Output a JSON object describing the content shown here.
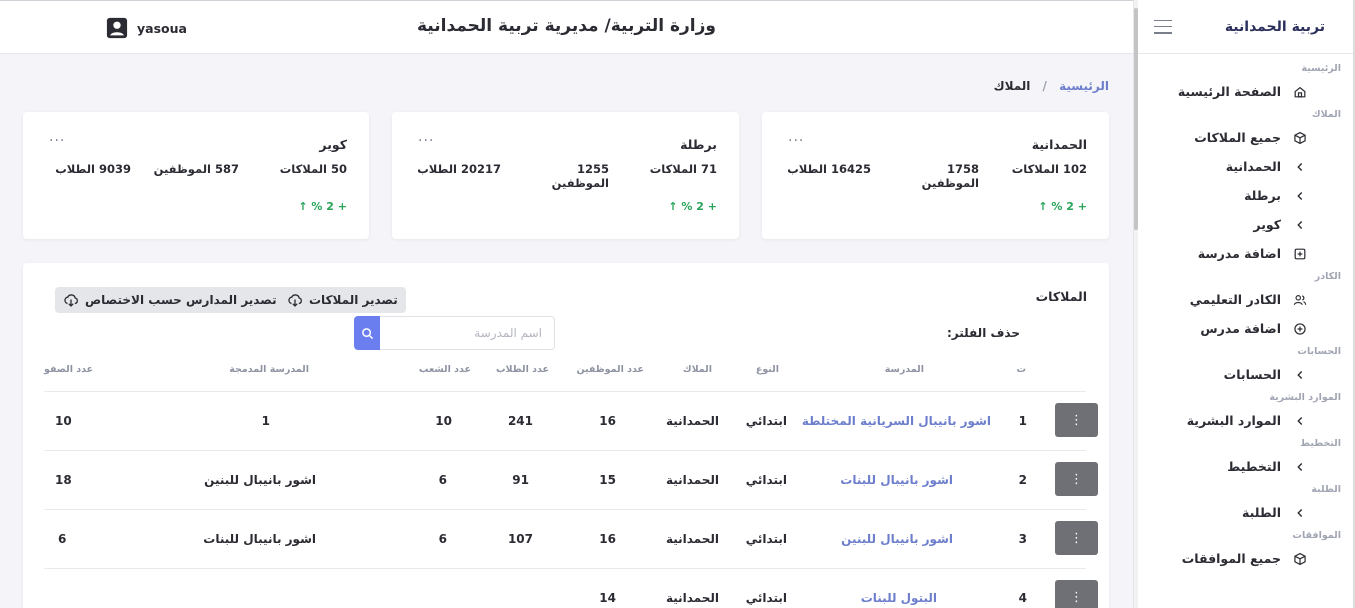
{
  "header": {
    "title": "وزارة التربية/ مديرية تربية الحمدانية",
    "username": "yasoua"
  },
  "sidebar": {
    "title": "تربية الحمدانية",
    "sections": {
      "home": "الرئيسية",
      "schools": "الملاك",
      "staff": "الكادر",
      "accounts": "الحسابات",
      "hr": "الموارد البشرية",
      "planning": "التخطيط",
      "students": "الطلبة",
      "approvals": "الموافقات"
    },
    "items": {
      "home_page": "الصفحة الرئيسية",
      "all_schools": "جميع الملاكات",
      "hamdaniya": "الحمدانية",
      "bartella": "برطلة",
      "kuwair": "كوير",
      "add_school": "اضافة مدرسة",
      "teaching_staff": "الكادر التعليمي",
      "add_teacher": "اضافة مدرس",
      "accounts": "الحسابات",
      "hr": "الموارد البشرية",
      "planning": "التخطيط",
      "students": "الطلبة",
      "all_approvals": "جميع الموافقات"
    }
  },
  "breadcrumb": {
    "home": "الرئيسية",
    "separator": "/",
    "current": "الملاك"
  },
  "cards": [
    {
      "name": "الحمدانية",
      "schools": "102 الملاكات",
      "employees_line1": "1758",
      "employees_line2": "الموظفين",
      "students": "16425 الطلاب",
      "trend": "+ 2 % ↑",
      "menu": "···"
    },
    {
      "name": "برطلة",
      "schools": "71 الملاكات",
      "employees_line1": "1255",
      "employees_line2": "الموظفين",
      "students": "20217 الطلاب",
      "trend": "+ 2 % ↑",
      "menu": "···"
    },
    {
      "name": "كوير",
      "schools": "50 الملاكات",
      "employees": "587 الموظفين",
      "students": "9039 الطلاب",
      "trend": "+ 2 % ↑",
      "menu": "···"
    }
  ],
  "table_section": {
    "title": "الملاكات",
    "export_schools": "تصدير الملاكات",
    "export_by_specialty": "تصدير المدارس حسب الاختصاص",
    "clear_filter": "حذف الفلتر:",
    "search_placeholder": "اسم المدرسة",
    "columns": {
      "index": "ت",
      "school": "المدرسة",
      "type": "النوع",
      "malak": "الملاك",
      "employees": "عدد الموظفين",
      "students": "عدد الطلاب",
      "sections": "عدد الشعب",
      "merged": "المدرسة المدمجة",
      "classes": "عدد الصفو"
    },
    "rows": [
      {
        "index": "1",
        "school": "اشور بانيبال السريانية المختلطة",
        "type": "ابتدائي",
        "malak": "الحمدانية",
        "employees": "16",
        "students": "241",
        "sections": "10",
        "merged": "1",
        "classes": "10"
      },
      {
        "index": "2",
        "school": "اشور بانيبال للبنات",
        "type": "ابتدائي",
        "malak": "الحمدانية",
        "employees": "15",
        "students": "91",
        "sections": "6",
        "merged": "اشور بانيبال للبنين",
        "classes": "18"
      },
      {
        "index": "3",
        "school": "اشور بانيبال للبنين",
        "type": "ابتدائي",
        "malak": "الحمدانية",
        "employees": "16",
        "students": "107",
        "sections": "6",
        "merged": "اشور بانيبال للبنات",
        "classes": "6"
      },
      {
        "index": "4",
        "school": "البتول للبنات",
        "type": "ابتدائي",
        "malak": "الحمدانية",
        "employees": "14",
        "students": "",
        "sections": "",
        "merged": "",
        "classes": ""
      }
    ],
    "row_action": "⋮"
  }
}
